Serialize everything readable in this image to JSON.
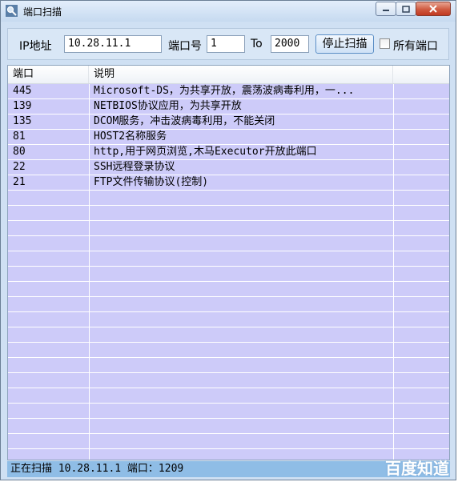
{
  "window": {
    "title": "端口扫描"
  },
  "toolbar": {
    "ip_label": "IP地址",
    "ip_value": "10.28.11.1",
    "port_label": "端口号",
    "port_from": "1",
    "to_label": "To",
    "port_to": "2000",
    "stop_button": "停止扫描",
    "all_ports_label": "所有端口"
  },
  "table": {
    "headers": [
      "端口",
      "说明"
    ],
    "rows": [
      {
        "port": "445",
        "desc": "Microsoft-DS，为共享开放，震荡波病毒利用，一..."
      },
      {
        "port": "139",
        "desc": "NETBIOS协议应用，为共享开放"
      },
      {
        "port": "135",
        "desc": "DCOM服务，冲击波病毒利用，不能关闭"
      },
      {
        "port": "81",
        "desc": "HOST2名称服务"
      },
      {
        "port": "80",
        "desc": "http,用于网页浏览,木马Executor开放此端口"
      },
      {
        "port": "22",
        "desc": "SSH远程登录协议"
      },
      {
        "port": "21",
        "desc": "FTP文件传输协议(控制)"
      }
    ]
  },
  "status": {
    "text": "正在扫描 10.28.11.1 端口：1209"
  },
  "watermark": {
    "text": "百度知道"
  },
  "colors": {
    "row_bg": "#cdcbf9",
    "status_bg": "#8fbde6"
  }
}
